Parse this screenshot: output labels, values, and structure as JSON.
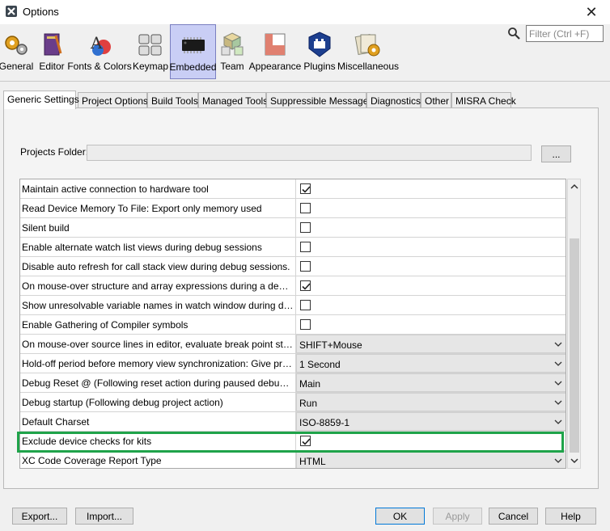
{
  "window": {
    "title": "Options",
    "close_glyph": "✕"
  },
  "toolbar": {
    "items": [
      {
        "label": "General",
        "icon": "gears-icon"
      },
      {
        "label": "Editor",
        "icon": "editor-icon"
      },
      {
        "label": "Fonts & Colors",
        "icon": "fonts-colors-icon"
      },
      {
        "label": "Keymap",
        "icon": "keymap-icon"
      },
      {
        "label": "Embedded",
        "icon": "chip-icon",
        "selected": true
      },
      {
        "label": "Team",
        "icon": "team-icon"
      },
      {
        "label": "Appearance",
        "icon": "appearance-icon"
      },
      {
        "label": "Plugins",
        "icon": "plugins-icon"
      },
      {
        "label": "Miscellaneous",
        "icon": "misc-icon"
      }
    ]
  },
  "search": {
    "placeholder": "Filter (Ctrl +F)"
  },
  "tabs": [
    {
      "label": "Generic Settings",
      "active": true
    },
    {
      "label": "Project Options"
    },
    {
      "label": "Build Tools"
    },
    {
      "label": "Managed Tools"
    },
    {
      "label": "Suppressible Messages"
    },
    {
      "label": "Diagnostics"
    },
    {
      "label": "Other"
    },
    {
      "label": "MISRA Check"
    }
  ],
  "projects_folder": {
    "label": "Projects Folder:",
    "value": "",
    "browse_label": "..."
  },
  "settings": [
    {
      "name": "Maintain active connection to hardware tool",
      "type": "checkbox",
      "checked": true
    },
    {
      "name": "Read Device Memory To File: Export only memory used",
      "type": "checkbox",
      "checked": false
    },
    {
      "name": "Silent build",
      "type": "checkbox",
      "checked": false
    },
    {
      "name": "Enable alternate watch list views during debug sessions",
      "type": "checkbox",
      "checked": false
    },
    {
      "name": "Disable auto refresh for call stack view during debug sessions.",
      "type": "checkbox",
      "checked": false
    },
    {
      "name": "On mouse-over structure and array expressions during a debug ses...",
      "type": "checkbox",
      "checked": true
    },
    {
      "name": "Show unresolvable variable names in watch window during debug s...",
      "type": "checkbox",
      "checked": false
    },
    {
      "name": "Enable Gathering of Compiler symbols",
      "type": "checkbox",
      "checked": false
    },
    {
      "name": "On mouse-over source lines in editor, evaluate break point status.",
      "type": "select",
      "value": "SHIFT+Mouse"
    },
    {
      "name": "Hold-off period before memory view synchronization: Give priority ...",
      "type": "select",
      "value": "1 Second"
    },
    {
      "name": "Debug Reset @    (Following reset action during paused debug ses...",
      "type": "select",
      "value": "Main"
    },
    {
      "name": "Debug startup    (Following debug project action)",
      "type": "select",
      "value": "Run"
    },
    {
      "name": "Default Charset",
      "type": "select",
      "value": "ISO-8859-1"
    },
    {
      "name": "Exclude device checks for kits",
      "type": "checkbox",
      "checked": true,
      "highlighted": true
    },
    {
      "name": "XC Code Coverage Report Type",
      "type": "select",
      "value": "HTML"
    }
  ],
  "buttons": {
    "export": "Export...",
    "import": "Import...",
    "ok": "OK",
    "apply": "Apply",
    "cancel": "Cancel",
    "help": "Help"
  },
  "colors": {
    "highlight": "#1fa34a",
    "selected_tool": "#c9cef5",
    "default_button_border": "#0078d7"
  }
}
